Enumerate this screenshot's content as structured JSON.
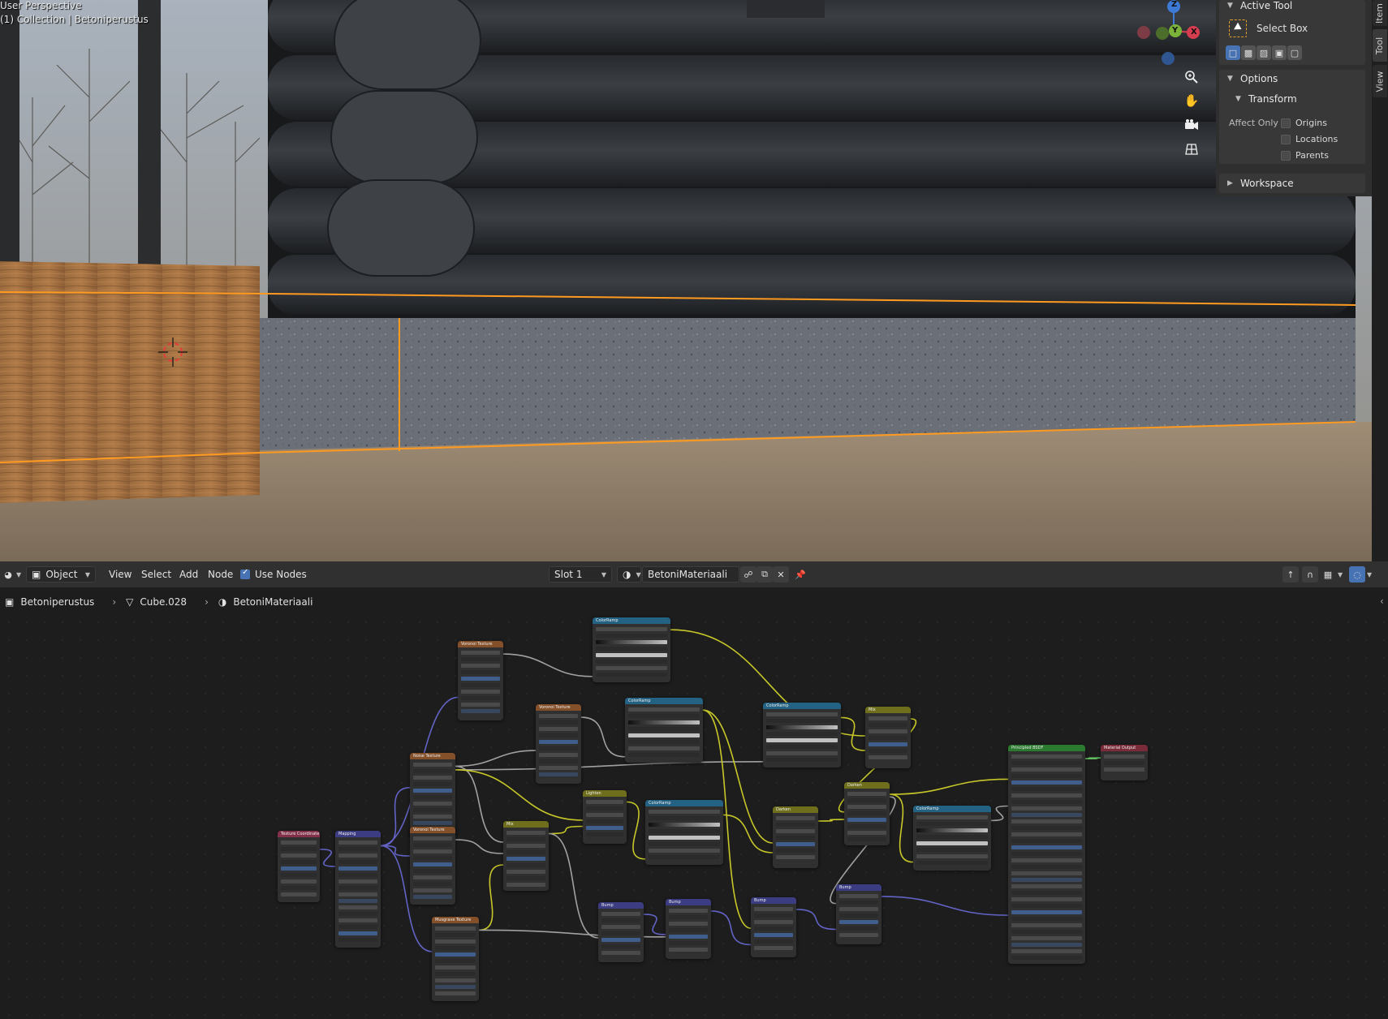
{
  "viewport": {
    "perspective_label": "User Perspective",
    "collection_label": "(1) Collection | Betoniperustus",
    "gizmo": {
      "z": "Z",
      "y": "Y",
      "x": "X"
    }
  },
  "sidebar": {
    "tabs": [
      "Item",
      "Tool",
      "View"
    ],
    "active_tab": "Tool",
    "active_tool": {
      "header": "Active Tool",
      "tool_name": "Select Box"
    },
    "options": {
      "header": "Options",
      "transform_header": "Transform",
      "affect_only_label": "Affect Only",
      "checkboxes": [
        {
          "label": "Origins",
          "checked": false
        },
        {
          "label": "Locations",
          "checked": false
        },
        {
          "label": "Parents",
          "checked": false
        }
      ]
    },
    "workspace": {
      "header": "Workspace"
    }
  },
  "node_header": {
    "mode": "Object",
    "menus": [
      "View",
      "Select",
      "Add",
      "Node"
    ],
    "use_nodes_label": "Use Nodes",
    "use_nodes": true,
    "slot": "Slot 1",
    "material": "BetoniMateriaali"
  },
  "breadcrumb": {
    "object": "Betoniperustus",
    "mesh": "Cube.028",
    "material": "BetoniMateriaali"
  },
  "nodes": [
    {
      "id": "texcoord",
      "title": "Texture Coordinate",
      "color": "#83314a"
    },
    {
      "id": "mapping",
      "title": "Mapping",
      "color": "#3c3c83"
    },
    {
      "id": "voronoi1",
      "title": "Voronoi Texture",
      "color": "#83502a"
    },
    {
      "id": "noise",
      "title": "Noise Texture",
      "color": "#83502a"
    },
    {
      "id": "voronoi2",
      "title": "Voronoi Texture",
      "color": "#83502a"
    },
    {
      "id": "musgrave",
      "title": "Musgrave Texture",
      "color": "#83502a"
    },
    {
      "id": "voronoi3",
      "title": "Voronoi Texture",
      "color": "#83502a"
    },
    {
      "id": "mix1",
      "title": "Mix",
      "color": "#6e6e1c"
    },
    {
      "id": "lighten",
      "title": "Lighten",
      "color": "#6e6e1c"
    },
    {
      "id": "ramp1",
      "title": "ColorRamp",
      "color": "#246283"
    },
    {
      "id": "ramp2",
      "title": "ColorRamp",
      "color": "#246283"
    },
    {
      "id": "ramp3",
      "title": "ColorRamp",
      "color": "#246283"
    },
    {
      "id": "ramp4",
      "title": "ColorRamp",
      "color": "#246283"
    },
    {
      "id": "ramp5",
      "title": "ColorRamp",
      "color": "#246283"
    },
    {
      "id": "darken1",
      "title": "Darken",
      "color": "#6e6e1c"
    },
    {
      "id": "darken2",
      "title": "Darken",
      "color": "#6e6e1c"
    },
    {
      "id": "mix2",
      "title": "Mix",
      "color": "#6e6e1c"
    },
    {
      "id": "bump1",
      "title": "Bump",
      "color": "#3c3c83"
    },
    {
      "id": "bump2",
      "title": "Bump",
      "color": "#3c3c83"
    },
    {
      "id": "bump3",
      "title": "Bump",
      "color": "#3c3c83"
    },
    {
      "id": "bump4",
      "title": "Bump",
      "color": "#3c3c83"
    },
    {
      "id": "bsdf",
      "title": "Principled BSDF",
      "color": "#2b7a2f"
    },
    {
      "id": "output",
      "title": "Material Output",
      "color": "#7a2b3a"
    }
  ],
  "colors": {
    "selection_outline": "#ff9a20",
    "link_color": "#c7c729",
    "link_vector": "#6363c7",
    "link_float": "#a1a1a1",
    "link_shader": "#63c763"
  }
}
